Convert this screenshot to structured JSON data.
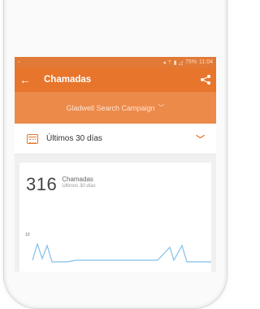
{
  "status_bar": {
    "time": "11:04",
    "battery": "75%"
  },
  "app_bar": {
    "title": "Chamadas",
    "back_icon": "arrow-left-icon",
    "share_icon": "share-icon"
  },
  "campaign": {
    "name": "Gladwell Search Campaign"
  },
  "date_range": {
    "label": "Últimos 30 días"
  },
  "kpi": {
    "value": "316",
    "label": "Chamadas",
    "period": "Últimos 30 días"
  },
  "chart": {
    "y_tick": "10"
  },
  "colors": {
    "accent": "#e8752c",
    "campaign_bg": "#ec8a4a",
    "line": "#7fc1e8"
  }
}
